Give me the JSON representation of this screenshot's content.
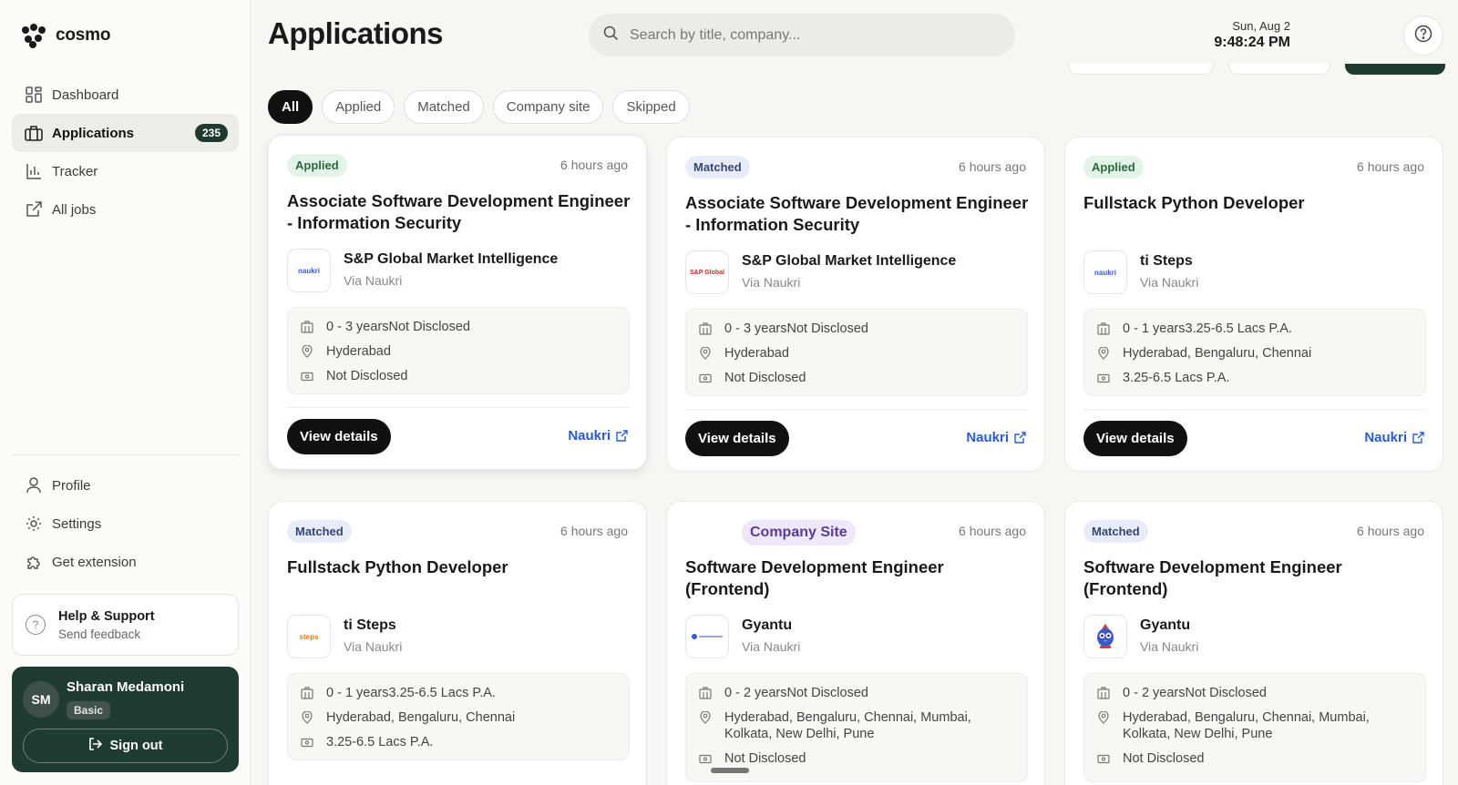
{
  "brand": {
    "name": "cosmo"
  },
  "sidebar": {
    "nav": [
      {
        "label": "Dashboard",
        "icon": "dashboard-icon"
      },
      {
        "label": "Applications",
        "icon": "briefcase-icon",
        "badge": "235",
        "active": true
      },
      {
        "label": "Tracker",
        "icon": "bar-chart-icon"
      },
      {
        "label": "All jobs",
        "icon": "external-link-icon"
      }
    ],
    "nav2": [
      {
        "label": "Profile",
        "icon": "user-icon"
      },
      {
        "label": "Settings",
        "icon": "gear-icon"
      },
      {
        "label": "Get extension",
        "icon": "puzzle-icon"
      }
    ],
    "help": {
      "title": "Help & Support",
      "subtitle": "Send feedback"
    },
    "user": {
      "initials": "SM",
      "name": "Sharan Medamoni",
      "plan": "Basic",
      "signout": "Sign out"
    }
  },
  "header": {
    "title": "Applications",
    "search_placeholder": "Search by title, company...",
    "date": "Sun, Aug 2",
    "time": "9:48:24 PM"
  },
  "filters": [
    "All",
    "Applied",
    "Matched",
    "Company site",
    "Skipped"
  ],
  "cards": [
    {
      "status": "Applied",
      "status_class": "applied",
      "time_ago": "6 hours ago",
      "title": "Associate Software Development Engineer - Information Security",
      "logo_text": "naukri",
      "company": "S&P Global Market Intelligence",
      "via": "Via Naukri",
      "experience": "0 - 3 yearsNot Disclosed",
      "location": "Hyderabad",
      "salary": "Not Disclosed",
      "cta": "View details",
      "source": "Naukri"
    },
    {
      "status": "Matched",
      "status_class": "matched",
      "time_ago": "6 hours ago",
      "title": "Associate Software Development Engineer - Information Security",
      "logo_text": "S&P Global",
      "company": "S&P Global Market Intelligence",
      "via": "Via Naukri",
      "experience": "0 - 3 yearsNot Disclosed",
      "location": "Hyderabad",
      "salary": "Not Disclosed",
      "cta": "View details",
      "source": "Naukri"
    },
    {
      "status": "Applied",
      "status_class": "applied",
      "time_ago": "6 hours ago",
      "title": "Fullstack Python Developer",
      "logo_text": "naukri",
      "company": "ti Steps",
      "via": "Via Naukri",
      "experience": "0 - 1 years3.25-6.5 Lacs P.A.",
      "location": "Hyderabad, Bengaluru, Chennai",
      "salary": "3.25-6.5 Lacs P.A.",
      "cta": "View details",
      "source": "Naukri"
    },
    {
      "status": "Matched",
      "status_class": "matched",
      "time_ago": "6 hours ago",
      "title": "Fullstack Python Developer",
      "logo_text": "steps",
      "company": "ti Steps",
      "via": "Via Naukri",
      "experience": "0 - 1 years3.25-6.5 Lacs P.A.",
      "location": "Hyderabad, Bengaluru, Chennai",
      "salary": "3.25-6.5 Lacs P.A."
    },
    {
      "status": "Company Site",
      "status_class": "company",
      "time_ago": "6 hours ago",
      "title": "Software Development Engineer (Frontend)",
      "logo_text": "",
      "company": "Gyantu",
      "via": "Via Naukri",
      "experience": "0 - 2 yearsNot Disclosed",
      "location": "Hyderabad, Bengaluru, Chennai, Mumbai, Kolkata, New Delhi, Pune",
      "salary": "Not Disclosed"
    },
    {
      "status": "Matched",
      "status_class": "matched",
      "time_ago": "6 hours ago",
      "title": "Software Development Engineer (Frontend)",
      "logo_text": "",
      "company": "Gyantu",
      "via": "Via Naukri",
      "experience": "0 - 2 yearsNot Disclosed",
      "location": "Hyderabad, Bengaluru, Chennai, Mumbai, Kolkata, New Delhi, Pune",
      "salary": "Not Disclosed"
    }
  ]
}
